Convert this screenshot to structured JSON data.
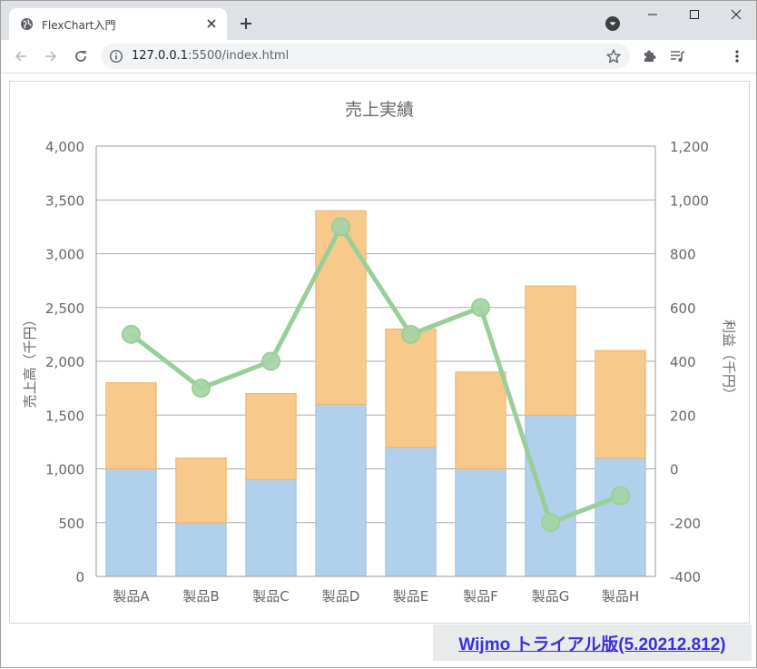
{
  "browser": {
    "tab_title": "FlexChart入門",
    "url_host": "127.0.0.1",
    "url_rest": ":5500/index.html"
  },
  "icons": {
    "favicon": "globe-icon",
    "close": "close-icon",
    "new_tab": "plus-icon",
    "tab_search": "chevron-down-icon",
    "minimize": "minimize-icon",
    "maximize": "maximize-icon",
    "window_close": "close-icon",
    "back": "arrow-left-icon",
    "forward": "arrow-right-icon",
    "reload": "reload-icon",
    "site_info": "info-icon",
    "bookmark": "star-icon",
    "extensions": "puzzle-icon",
    "reading_list": "playlist-icon",
    "menu": "more-vert-icon"
  },
  "colors": {
    "sales_bar": "#b0d0eb",
    "sales_bar_stroke": "#9ec3e3",
    "stack_bar": "#f7c98b",
    "stack_bar_stroke": "#f0b36a",
    "profit_line": "#98cf98",
    "profit_marker": "#a4d4a4",
    "wijmo_link": "#3a30d9"
  },
  "wijmo_badge": "Wijmo トライアル版(5.20212.812)",
  "chart_data": {
    "type": "bar",
    "title": "売上実績",
    "categories": [
      "製品A",
      "製品B",
      "製品C",
      "製品D",
      "製品E",
      "製品F",
      "製品G",
      "製品H"
    ],
    "series": [
      {
        "values": [
          1000,
          500,
          900,
          1600,
          1200,
          1000,
          1500,
          1100
        ],
        "stacked": true,
        "axis": "left"
      },
      {
        "values": [
          800,
          600,
          800,
          1800,
          1100,
          900,
          1200,
          1000
        ],
        "stacked": true,
        "axis": "left"
      },
      {
        "values": [
          500,
          300,
          400,
          900,
          500,
          600,
          -200,
          -100
        ],
        "type": "line",
        "markers": true,
        "axis": "right"
      }
    ],
    "ylabel": "売上高（千円）",
    "y2label": "利益（千円）",
    "ylim": [
      0,
      4000
    ],
    "y2lim": [
      -400,
      1200
    ],
    "yticks": [
      "0",
      "500",
      "1,000",
      "1,500",
      "2,000",
      "2,500",
      "3,000",
      "3,500",
      "4,000"
    ],
    "y2ticks": [
      "-400",
      "-200",
      "0",
      "200",
      "400",
      "600",
      "800",
      "1,000",
      "1,200"
    ],
    "grid": true,
    "legend": "none"
  }
}
